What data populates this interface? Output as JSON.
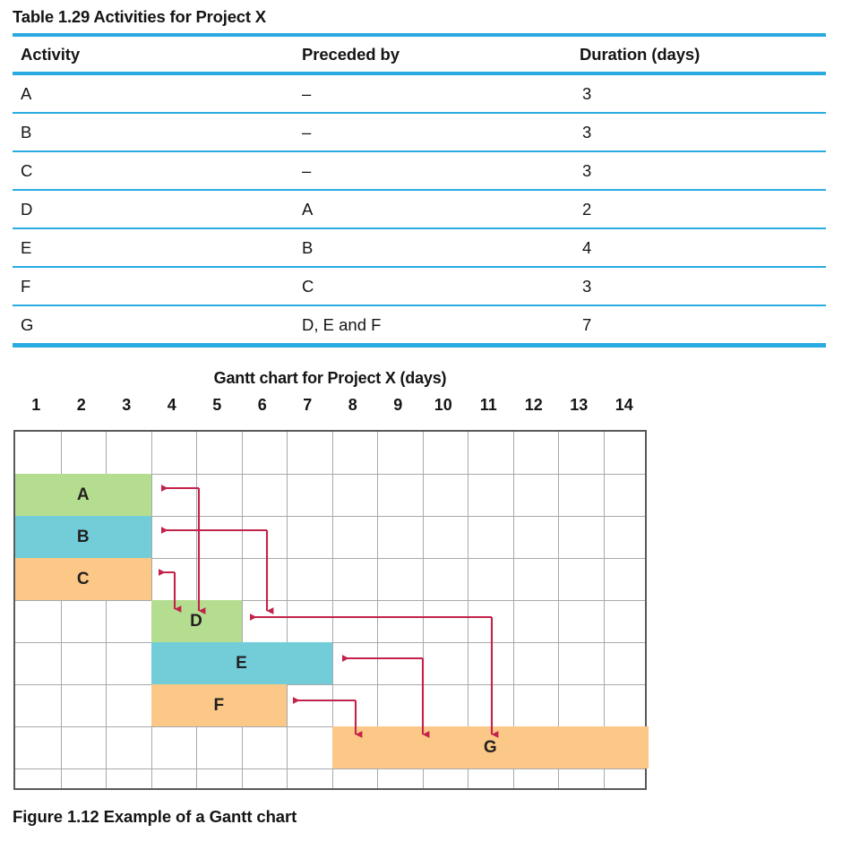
{
  "table": {
    "caption_prefix": "Table 1.29",
    "caption": "Table 1.29 Activities for Project X",
    "headers": [
      "Activity",
      "Preceded by",
      "Duration (days)"
    ],
    "rows": [
      {
        "activity": "A",
        "preceded_by": "–",
        "duration": "3"
      },
      {
        "activity": "B",
        "preceded_by": "–",
        "duration": "3"
      },
      {
        "activity": "C",
        "preceded_by": "–",
        "duration": "3"
      },
      {
        "activity": "D",
        "preceded_by": "A",
        "duration": "2"
      },
      {
        "activity": "E",
        "preceded_by": "B",
        "duration": "4"
      },
      {
        "activity": "F",
        "preceded_by": "C",
        "duration": "3"
      },
      {
        "activity": "G",
        "preceded_by": "D, E and F",
        "duration": "7"
      }
    ]
  },
  "gantt": {
    "title": "Gantt chart for Project X (days)",
    "axis_ticks": [
      "1",
      "2",
      "3",
      "4",
      "5",
      "6",
      "7",
      "8",
      "9",
      "10",
      "11",
      "12",
      "13",
      "14"
    ],
    "bar_labels": [
      "A",
      "B",
      "C",
      "D",
      "E",
      "F",
      "G"
    ]
  },
  "figure_caption": "Figure 1.12 Example of a Gantt chart",
  "colors": {
    "rule_blue": "#29abe2",
    "bar_green": "#b5dd90",
    "bar_blue": "#73cdd8",
    "bar_orange": "#fcc887",
    "arrow_red": "#c3224a",
    "grid_line": "#a7a9ac",
    "grid_border": "#58595b"
  },
  "chart_data": {
    "type": "bar",
    "title": "Gantt chart for Project X (days)",
    "xlabel": "days",
    "ylabel": "",
    "xlim": [
      0,
      14
    ],
    "grid": true,
    "legend": "none",
    "categories": [
      "A",
      "B",
      "C",
      "D",
      "E",
      "F",
      "G"
    ],
    "tasks": [
      {
        "name": "A",
        "start_day": 1,
        "duration": 3,
        "end_day": 3,
        "row": 1,
        "color": "#b5dd90",
        "preceded_by": "–"
      },
      {
        "name": "B",
        "start_day": 1,
        "duration": 3,
        "end_day": 3,
        "row": 2,
        "color": "#73cdd8",
        "preceded_by": "–"
      },
      {
        "name": "C",
        "start_day": 1,
        "duration": 3,
        "end_day": 3,
        "row": 3,
        "color": "#fcc887",
        "preceded_by": "–"
      },
      {
        "name": "D",
        "start_day": 4,
        "duration": 2,
        "end_day": 5,
        "row": 4,
        "color": "#b5dd90",
        "preceded_by": "A"
      },
      {
        "name": "E",
        "start_day": 4,
        "duration": 4,
        "end_day": 7,
        "row": 5,
        "color": "#73cdd8",
        "preceded_by": "B"
      },
      {
        "name": "F",
        "start_day": 4,
        "duration": 3,
        "end_day": 6,
        "row": 6,
        "color": "#fcc887",
        "preceded_by": "C"
      },
      {
        "name": "G",
        "start_day": 8,
        "duration": 7,
        "end_day": 14,
        "row": 7,
        "color": "#fcc887",
        "preceded_by": "D, E and F"
      }
    ],
    "dependencies": [
      {
        "from": "D",
        "to": "A"
      },
      {
        "from": "E",
        "to": "B"
      },
      {
        "from": "F",
        "to": "C"
      },
      {
        "from": "G",
        "to": "D"
      },
      {
        "from": "G",
        "to": "E"
      },
      {
        "from": "G",
        "to": "F"
      }
    ],
    "values": [
      3,
      3,
      3,
      2,
      4,
      3,
      7
    ]
  }
}
